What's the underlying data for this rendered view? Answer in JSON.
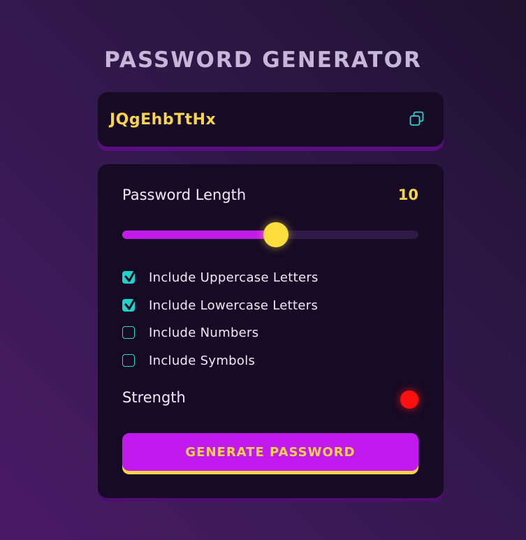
{
  "app": {
    "title": "PASSWORD GENERATOR"
  },
  "display": {
    "password": "JQgEhbTtHx",
    "copy_icon": "copy-icon"
  },
  "length": {
    "label": "Password Length",
    "value": "10",
    "slider_fraction": 0.52
  },
  "options": [
    {
      "label": "Include Uppercase Letters",
      "checked": true
    },
    {
      "label": "Include Lowercase Letters",
      "checked": true
    },
    {
      "label": "Include Numbers",
      "checked": false
    },
    {
      "label": "Include Symbols",
      "checked": false
    }
  ],
  "strength": {
    "label": "Strength",
    "indicator_color": "#ff1010"
  },
  "generate": {
    "label": "GENERATE PASSWORD"
  },
  "colors": {
    "accent_yellow": "#f7d44a",
    "accent_purple": "#c119ee",
    "checkbox_teal": "#1fd3cc"
  }
}
